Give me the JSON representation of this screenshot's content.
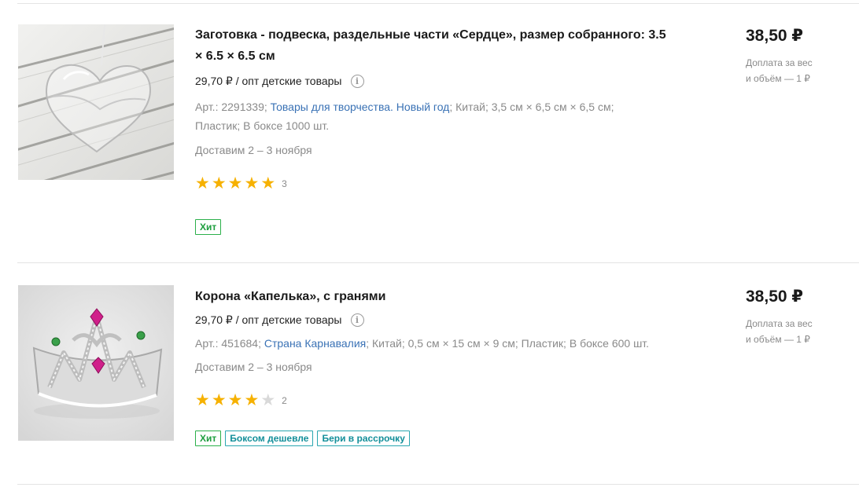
{
  "products": [
    {
      "title": "Заготовка - подвеска, раздельные части «Сердце», размер собранного: 3.5 × 6.5 × 6.5 см",
      "wholesale": "29,70 ₽ / опт детские товары",
      "info_icon": "i",
      "article": "Арт.: 2291339;",
      "category_link": "Товары для творчества. Новый год",
      "meta_rest_1": "; Китай; 3,5 см × 6,5 см × 6,5 см;",
      "meta_rest_2": "Пластик; В боксе 1000 шт.",
      "delivery": "Доставим 2 – 3 ноября",
      "rating": 5,
      "rating_count": "3",
      "badges": [
        "Хит"
      ],
      "price": "38,50 ₽",
      "extra_line1": "Доплата за вес",
      "extra_line2": "и объём — 1 ₽"
    },
    {
      "title": "Корона «Капелька», с гранями",
      "wholesale": "29,70 ₽ / опт детские товары",
      "info_icon": "i",
      "article": "Арт.: 451684;",
      "category_link": "Страна Карнавалия",
      "meta_rest_1": "; Китай; 0,5 см × 15 см × 9 см; Пластик; В боксе 600 шт.",
      "meta_rest_2": "",
      "delivery": "Доставим 2 – 3 ноября",
      "rating": 4,
      "rating_count": "2",
      "badges": [
        "Хит",
        "Боксом дешевле",
        "Бери в рассрочку"
      ],
      "price": "38,50 ₽",
      "extra_line1": "Доплата за вес",
      "extra_line2": "и объём — 1 ₽"
    }
  ],
  "colors": {
    "star": "#f6b100",
    "star_empty": "#d9d9d9",
    "link": "#3a72b5",
    "badge_green": "#1e9e3e",
    "badge_teal": "#138f9a"
  }
}
